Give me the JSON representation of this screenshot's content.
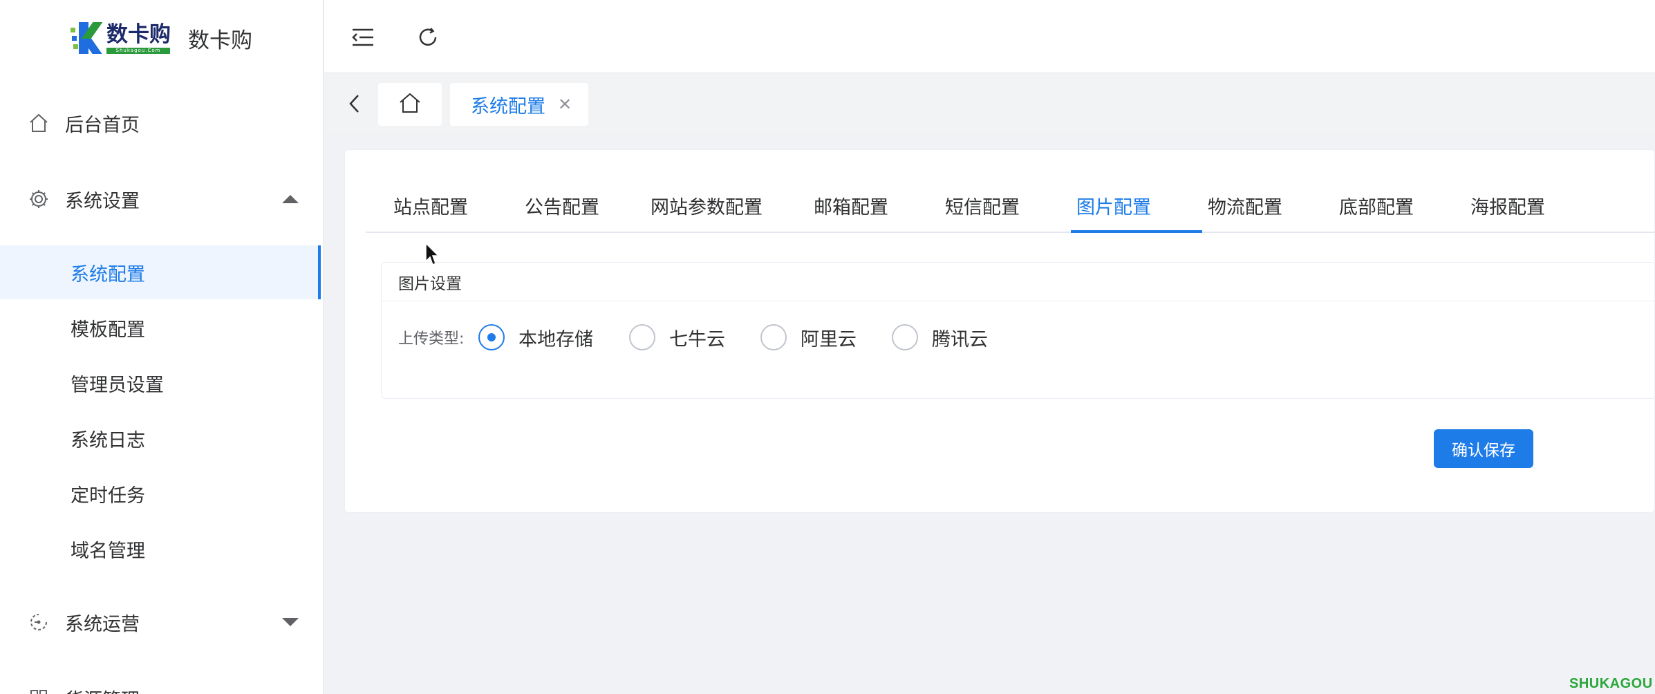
{
  "brand": {
    "logo_text": "数卡购",
    "logo_subtext": "Shukagou.Com",
    "title": "数卡购"
  },
  "sidebar": {
    "items": [
      {
        "label": "后台首页",
        "icon": "home-icon"
      },
      {
        "label": "系统设置",
        "icon": "gear-icon",
        "expanded": true,
        "children": [
          "系统配置",
          "模板配置",
          "管理员设置",
          "系统日志",
          "定时任务",
          "域名管理"
        ],
        "active_child": "系统配置"
      },
      {
        "label": "系统运营",
        "icon": "operations-icon",
        "expanded": false
      },
      {
        "label": "货源管理",
        "icon": "grid-icon",
        "expanded": false
      }
    ]
  },
  "header": {
    "icons": [
      "collapse-menu-icon",
      "refresh-icon"
    ]
  },
  "tags": {
    "active": "系统配置"
  },
  "tabs": {
    "items": [
      "站点配置",
      "公告配置",
      "网站参数配置",
      "邮箱配置",
      "短信配置",
      "图片配置",
      "物流配置",
      "底部配置",
      "海报配置"
    ],
    "active": "图片配置"
  },
  "panel": {
    "title": "图片设置",
    "upload_label": "上传类型:",
    "options": [
      "本地存储",
      "七牛云",
      "阿里云",
      "腾讯云"
    ],
    "selected": "本地存储"
  },
  "actions": {
    "save_label": "确认保存"
  },
  "watermark": "SHUKAGOU",
  "colors": {
    "primary": "#1d7ce8",
    "active_bg": "#eef5fe",
    "brand_green": "#2aa63a",
    "brand_navy": "#1c2a6b"
  }
}
